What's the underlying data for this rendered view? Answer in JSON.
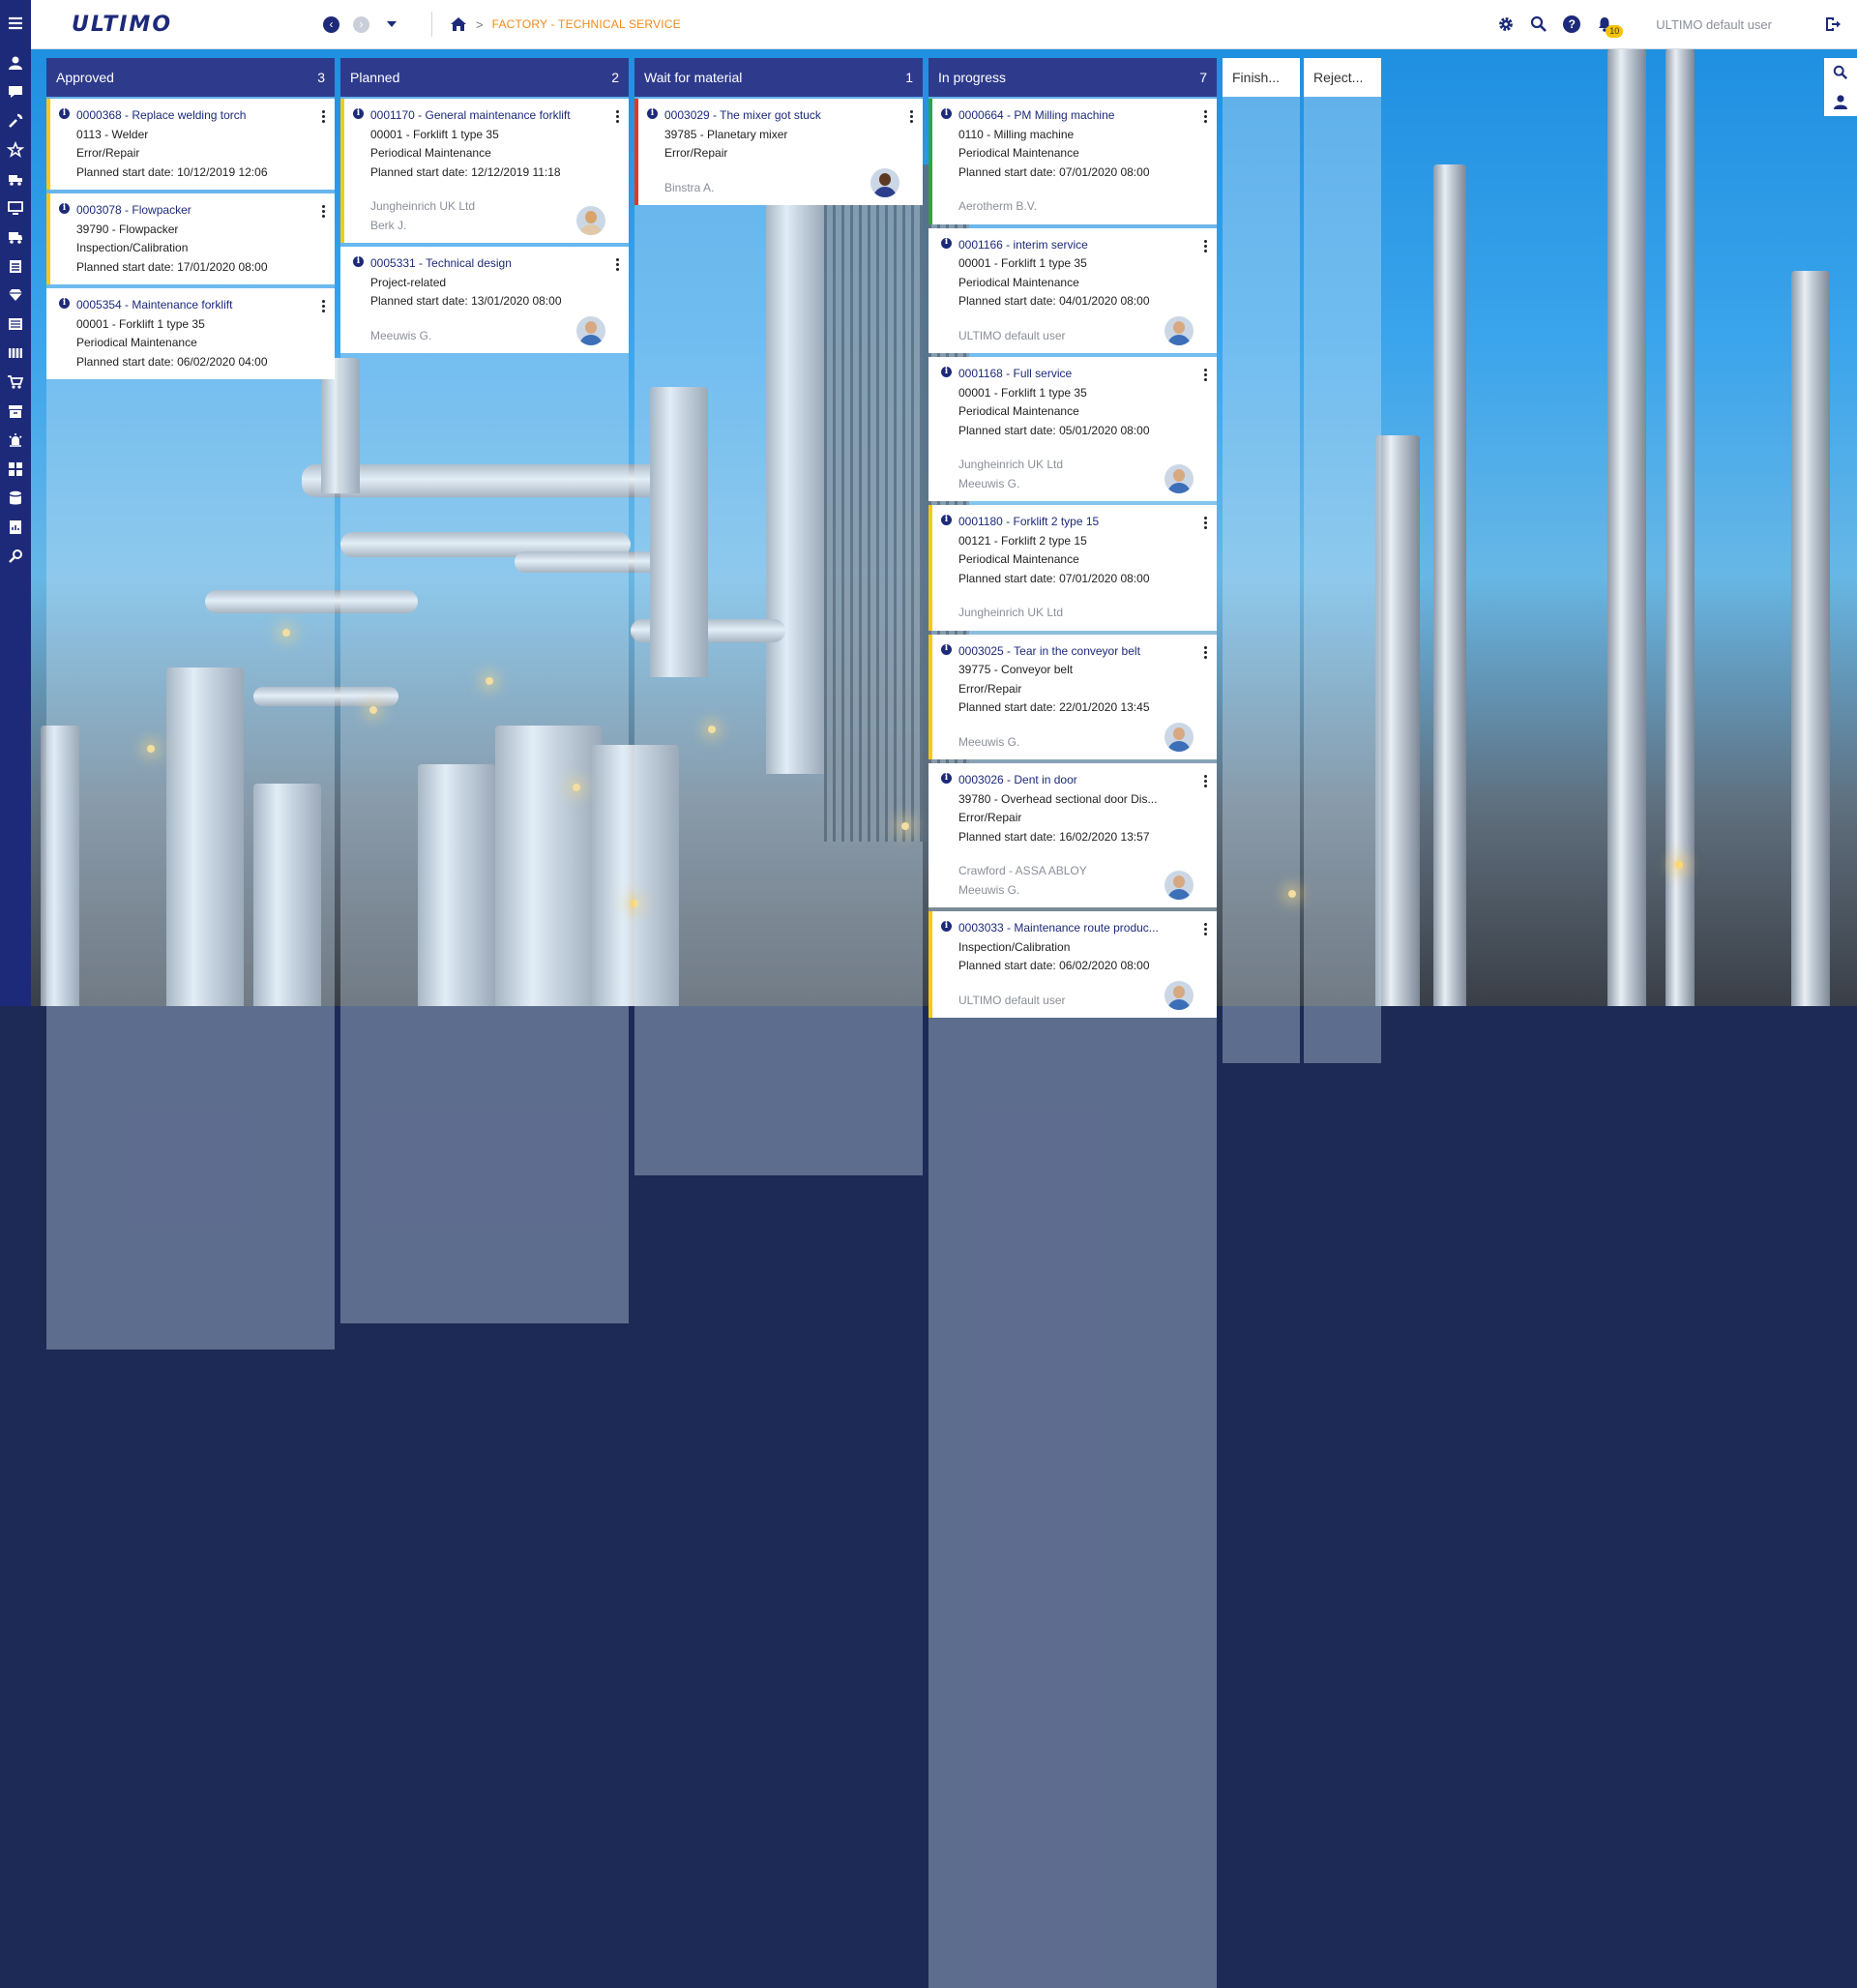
{
  "app": {
    "logo": "ULTIMO",
    "breadcrumb": "FACTORY - TECHNICAL SERVICE",
    "user": "ULTIMO default user",
    "notification_count": "10"
  },
  "rail_icons": [
    "menu-icon",
    "person-icon",
    "message-icon",
    "wrench-icon",
    "star-icon",
    "truck-icon",
    "monitor-icon",
    "vehicle-icon",
    "calendar-icon",
    "diamond-icon",
    "list-icon",
    "film-icon",
    "cart-icon",
    "archive-icon",
    "alarm-icon",
    "grid-icon",
    "database-icon",
    "report-icon",
    "settings-tools-icon"
  ],
  "columns": [
    {
      "title": "Approved",
      "count": "3",
      "cards": [
        {
          "title": "0000368 - Replace welding torch",
          "lines": [
            "0113 - Welder",
            "Error/Repair",
            "Planned start date: 10/12/2019 12:06"
          ],
          "extra": [],
          "accent": "yellow",
          "avatar": null
        },
        {
          "title": "0003078 - Flowpacker",
          "lines": [
            "39790 - Flowpacker",
            "Inspection/Calibration",
            "Planned start date: 17/01/2020 08:00"
          ],
          "extra": [],
          "accent": "yellow",
          "avatar": null
        },
        {
          "title": "0005354 - Maintenance forklift",
          "lines": [
            "00001 - Forklift 1 type 35",
            "Periodical Maintenance",
            "Planned start date: 06/02/2020 04:00"
          ],
          "extra": [],
          "accent": "none",
          "avatar": null
        }
      ]
    },
    {
      "title": "Planned",
      "count": "2",
      "cards": [
        {
          "title": "0001170 - General maintenance forklift",
          "lines": [
            "00001 - Forklift 1 type 35",
            "Periodical Maintenance",
            "Planned start date: 12/12/2019 11:18"
          ],
          "extra": [
            "Jungheinrich UK Ltd",
            "Berk J."
          ],
          "accent": "yellow",
          "avatar": "woman"
        },
        {
          "title": "0005331 - Technical design",
          "lines": [
            "Project-related",
            "Planned start date: 13/01/2020 08:00"
          ],
          "extra": [
            "Meeuwis G."
          ],
          "accent": "none",
          "avatar": "man"
        }
      ]
    },
    {
      "title": "Wait for material",
      "count": "1",
      "cards": [
        {
          "title": "0003029 - The mixer got stuck",
          "lines": [
            "39785 - Planetary mixer",
            "Error/Repair"
          ],
          "extra": [
            "Binstra A."
          ],
          "accent": "red",
          "avatar": "dark"
        }
      ]
    },
    {
      "title": "In progress",
      "count": "7",
      "cards": [
        {
          "title": "0000664 - PM Milling machine",
          "lines": [
            "0110 - Milling machine",
            "Periodical Maintenance",
            "Planned start date: 07/01/2020 08:00"
          ],
          "extra": [
            "Aerotherm B.V."
          ],
          "accent": "green",
          "avatar": null
        },
        {
          "title": "0001166 - interim service",
          "lines": [
            "00001 - Forklift 1 type 35",
            "Periodical Maintenance",
            "Planned start date: 04/01/2020 08:00"
          ],
          "extra": [
            "ULTIMO default user"
          ],
          "accent": "none",
          "avatar": "man"
        },
        {
          "title": "0001168 - Full service",
          "lines": [
            "00001 - Forklift 1 type 35",
            "Periodical Maintenance",
            "Planned start date: 05/01/2020 08:00"
          ],
          "extra": [
            "Jungheinrich UK Ltd",
            "Meeuwis G."
          ],
          "accent": "none",
          "avatar": "man"
        },
        {
          "title": "0001180 - Forklift 2 type 15",
          "lines": [
            "00121 - Forklift 2 type 15",
            "Periodical Maintenance",
            "Planned start date: 07/01/2020 08:00"
          ],
          "extra": [
            "Jungheinrich UK Ltd"
          ],
          "accent": "yellow",
          "avatar": null
        },
        {
          "title": "0003025 - Tear in the conveyor belt",
          "lines": [
            "39775 - Conveyor belt",
            "Error/Repair",
            "Planned start date: 22/01/2020 13:45"
          ],
          "extra": [
            "Meeuwis G."
          ],
          "accent": "yellow",
          "avatar": "man"
        },
        {
          "title": "0003026 - Dent in door",
          "lines": [
            "39780 - Overhead sectional door Dis...",
            "Error/Repair",
            "Planned start date: 16/02/2020 13:57"
          ],
          "extra": [
            "Crawford - ASSA ABLOY",
            "Meeuwis G."
          ],
          "accent": "none",
          "avatar": "man"
        },
        {
          "title": "0003033 - Maintenance route produc...",
          "lines": [
            "Inspection/Calibration",
            "Planned start date: 06/02/2020 08:00"
          ],
          "extra": [
            "ULTIMO default user"
          ],
          "accent": "yellow",
          "avatar": "man"
        }
      ]
    }
  ],
  "collapsed_columns": [
    "Finish...",
    "Reject..."
  ],
  "colors": {
    "brand": "#1d2a7a",
    "header": "#2e3b8c",
    "breadcrumb": "#f28a1a",
    "yellow": "#f3cb16",
    "red": "#e2362a",
    "green": "#2fa34a"
  }
}
